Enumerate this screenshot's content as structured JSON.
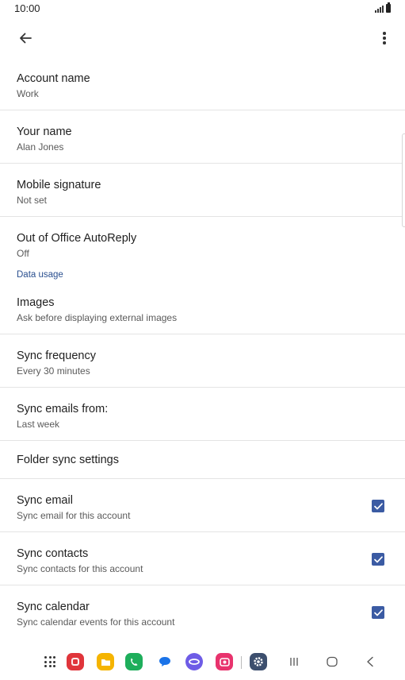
{
  "status_bar": {
    "time": "10:00"
  },
  "settings": {
    "account_name": {
      "title": "Account name",
      "value": "Work"
    },
    "your_name": {
      "title": "Your name",
      "value": "Alan Jones"
    },
    "mobile_signature": {
      "title": "Mobile signature",
      "value": "Not set"
    },
    "out_of_office": {
      "title": "Out of Office AutoReply",
      "value": "Off"
    },
    "data_usage_header": "Data usage",
    "images": {
      "title": "Images",
      "value": "Ask before displaying external images"
    },
    "sync_frequency": {
      "title": "Sync frequency",
      "value": "Every 30 minutes"
    },
    "sync_emails_from": {
      "title": "Sync emails from:",
      "value": "Last week"
    },
    "folder_sync": {
      "title": "Folder sync settings"
    },
    "sync_email": {
      "title": "Sync email",
      "value": "Sync email for this account",
      "checked": true
    },
    "sync_contacts": {
      "title": "Sync contacts",
      "value": "Sync contacts for this account",
      "checked": true
    },
    "sync_calendar": {
      "title": "Sync calendar",
      "value": "Sync calendar events for this account",
      "checked": true
    }
  },
  "nav_bar": {
    "apps": [
      {
        "name": "apps-grid-icon"
      },
      {
        "name": "flipboard-icon",
        "color": "#e0353b"
      },
      {
        "name": "my-files-icon",
        "color": "#f5b400"
      },
      {
        "name": "phone-icon",
        "color": "#1eae5b"
      },
      {
        "name": "messages-icon",
        "color": "#1a73e8"
      },
      {
        "name": "internet-icon",
        "color": "#6e5ce6"
      },
      {
        "name": "screen-recorder-icon",
        "color": "#e8336d"
      },
      {
        "name": "settings-icon",
        "color": "#3d4f6e"
      }
    ],
    "system": [
      "recents-icon",
      "home-icon",
      "back-icon"
    ]
  }
}
